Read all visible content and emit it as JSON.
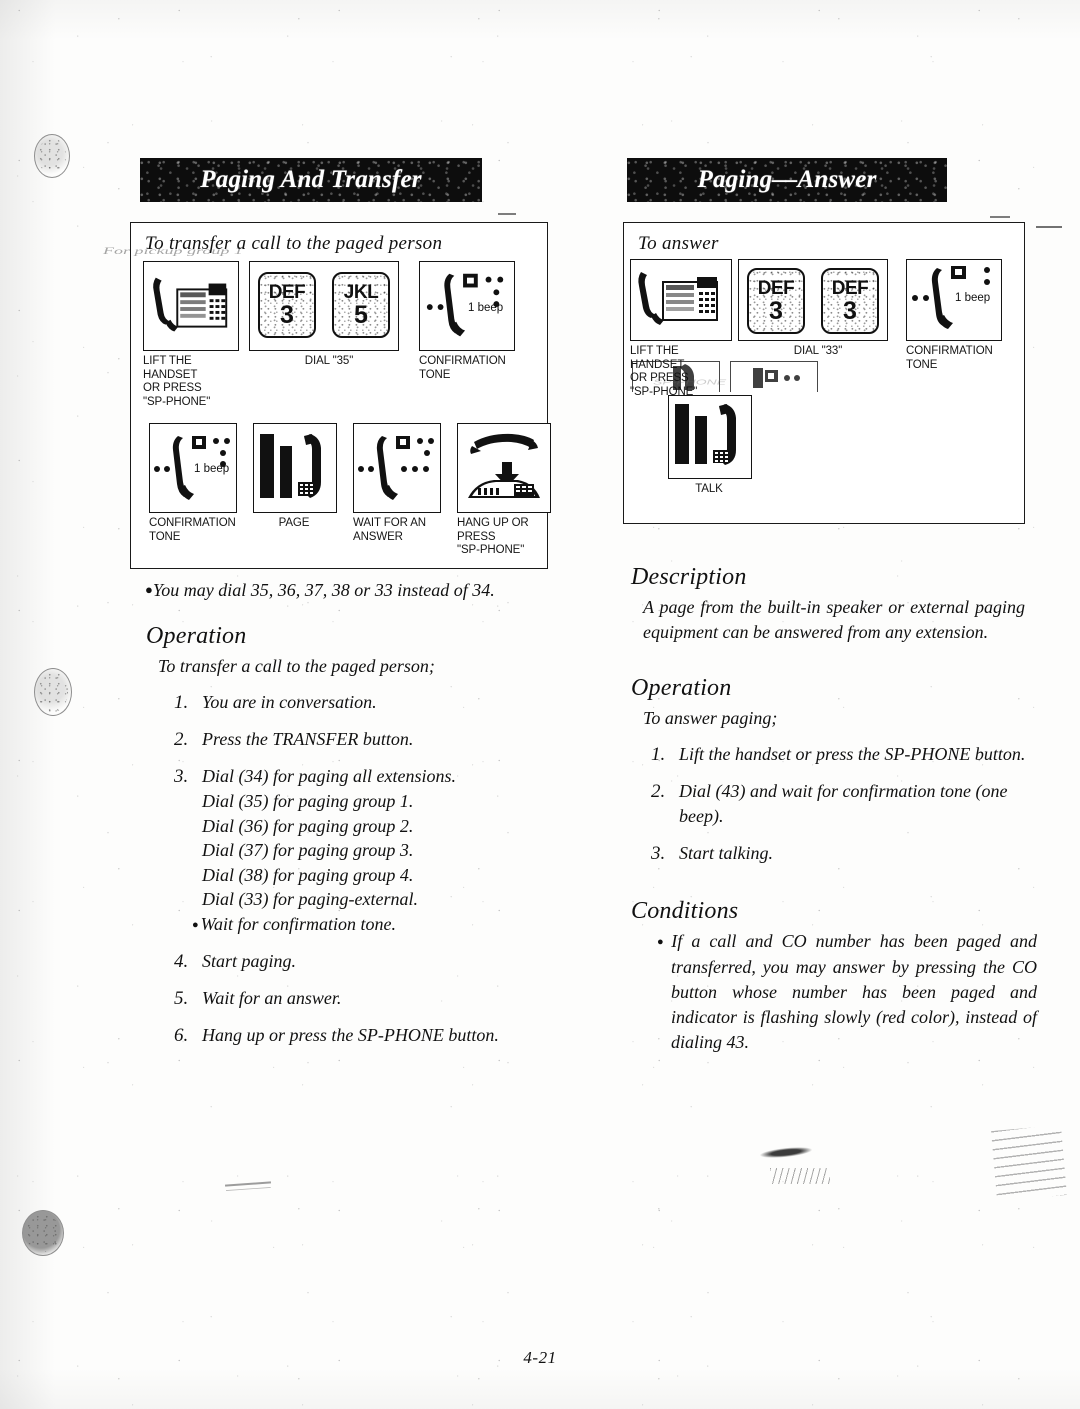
{
  "page": {
    "number": "4-21",
    "ghost_bleed_left": "For pickup group 1",
    "ghost_bleed_right": "SP-PHONE"
  },
  "left_column": {
    "banner_title": "Paging And Transfer",
    "illustration": {
      "title": "To transfer a call to the paged person",
      "row1": [
        {
          "icon": "desk-phone-lifted-handset-icon",
          "caption": "LIFT THE HANDSET\nOR PRESS\n\"SP-PHONE\""
        },
        {
          "icon": "dial-keys-icon",
          "keys": [
            {
              "letters": "DEF",
              "digit": "3"
            },
            {
              "letters": "JKL",
              "digit": "5"
            }
          ],
          "caption": "DIAL   \"35\""
        },
        {
          "icon": "handset-tone-icon",
          "beep_label": "1 beep",
          "caption": "CONFIRMATION\nTONE"
        }
      ],
      "row2": [
        {
          "icon": "handset-tone-icon",
          "beep_label": "1 beep",
          "caption": "CONFIRMATION\nTONE"
        },
        {
          "icon": "talk-handset-icon",
          "caption": "PAGE"
        },
        {
          "icon": "handset-waiting-icon",
          "caption": "WAIT FOR AN\nANSWER"
        },
        {
          "icon": "hang-up-handset-icon",
          "caption": "HANG UP OR\nPRESS\n\"SP-PHONE\""
        }
      ],
      "note": "You may dial 35, 36, 37, 38 or 33 instead of 34."
    },
    "operation": {
      "heading": "Operation",
      "lead": "To transfer a call to the paged person;",
      "steps": [
        {
          "num": "1.",
          "text": "You are in conversation."
        },
        {
          "num": "2.",
          "text": "Press the TRANSFER  button."
        },
        {
          "num": "3.",
          "text": "Dial (34) for paging all extensions.",
          "sub": [
            "Dial (35) for paging group 1.",
            "Dial (36) for paging group 2.",
            "Dial (37) for paging group 3.",
            "Dial (38) for paging group 4.",
            "Dial (33) for paging-external."
          ],
          "sub_bullet": "Wait for confirmation tone."
        },
        {
          "num": "4.",
          "text": "Start paging."
        },
        {
          "num": "5.",
          "text": "Wait for an answer."
        },
        {
          "num": "6.",
          "text": "Hang up or press the SP-PHONE button."
        }
      ]
    }
  },
  "right_column": {
    "banner_title": "Paging—Answer",
    "illustration": {
      "title": "To answer",
      "row1": [
        {
          "icon": "desk-phone-lifted-handset-icon",
          "caption": "LIFT THE HANDSET\nOR PRESS\n\"SP-PHONE\""
        },
        {
          "icon": "dial-keys-icon",
          "keys": [
            {
              "letters": "DEF",
              "digit": "3"
            },
            {
              "letters": "DEF",
              "digit": "3"
            }
          ],
          "caption": "DIAL \"33\""
        },
        {
          "icon": "handset-tone-icon",
          "beep_label": "1 beep",
          "caption": "CONFIRMATION\nTONE"
        }
      ],
      "row2": [
        {
          "icon": "talk-handset-icon",
          "caption": "TALK"
        }
      ]
    },
    "description": {
      "heading": "Description",
      "text": "A page from the built-in speaker or external paging equipment can be answered from any extension."
    },
    "operation": {
      "heading": "Operation",
      "lead": "To answer paging;",
      "steps": [
        {
          "num": "1.",
          "text": "Lift the handset or press the SP-PHONE button."
        },
        {
          "num": "2.",
          "text": "Dial (43) and wait for confirmation tone (one beep)."
        },
        {
          "num": "3.",
          "text": "Start talking."
        }
      ]
    },
    "conditions": {
      "heading": "Conditions",
      "items": [
        "If a call and CO number has been paged and transferred, you may answer by pressing the CO button whose number has been paged and indicator is flashing slowly (red color), instead of dialing 43."
      ]
    }
  }
}
